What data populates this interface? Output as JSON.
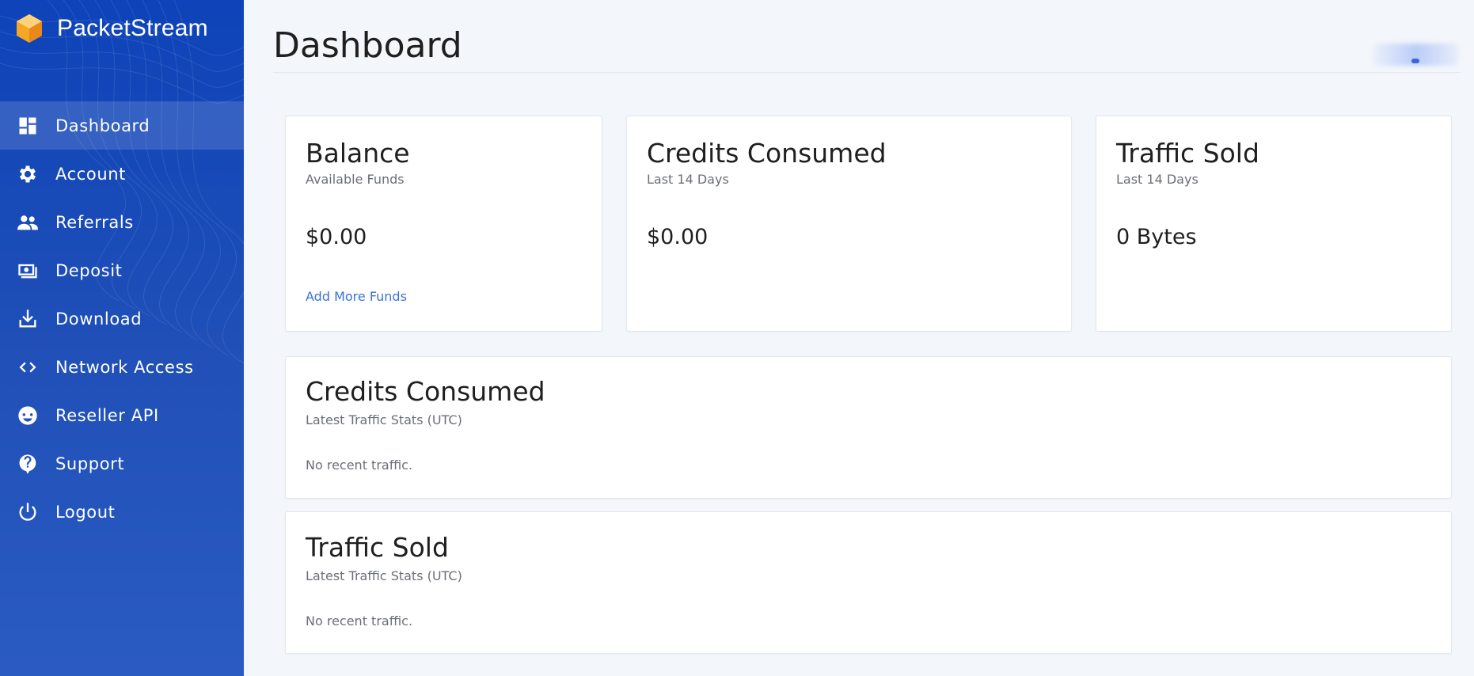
{
  "brand": {
    "name": "PacketStream",
    "logo_icon": "hexagon-cube-icon"
  },
  "sidebar": {
    "items": [
      {
        "label": "Dashboard",
        "icon": "dashboard-grid-icon",
        "active": true
      },
      {
        "label": "Account",
        "icon": "gear-icon"
      },
      {
        "label": "Referrals",
        "icon": "people-icon"
      },
      {
        "label": "Deposit",
        "icon": "cash-icon"
      },
      {
        "label": "Download",
        "icon": "download-tray-icon"
      },
      {
        "label": "Network Access",
        "icon": "code-brackets-icon"
      },
      {
        "label": "Reseller API",
        "icon": "api-face-icon"
      },
      {
        "label": "Support",
        "icon": "help-bubble-icon"
      },
      {
        "label": "Logout",
        "icon": "power-icon"
      }
    ]
  },
  "header": {
    "title": "Dashboard"
  },
  "cards": {
    "balance": {
      "title": "Balance",
      "subtitle": "Available Funds",
      "value": "$0.00",
      "link": "Add More Funds"
    },
    "credits_consumed": {
      "title": "Credits Consumed",
      "subtitle": "Last 14 Days",
      "value": "$0.00"
    },
    "traffic_sold": {
      "title": "Traffic Sold",
      "subtitle": "Last 14 Days",
      "value": "0 Bytes"
    }
  },
  "panels": {
    "credits_consumed": {
      "title": "Credits Consumed",
      "subtitle": "Latest Traffic Stats (UTC)",
      "empty": "No recent traffic."
    },
    "traffic_sold": {
      "title": "Traffic Sold",
      "subtitle": "Latest Traffic Stats (UTC)",
      "empty": "No recent traffic."
    }
  },
  "colors": {
    "sidebar_top": "#0e43b9",
    "sidebar_bottom": "#2a5bc2",
    "link": "#3a72d8",
    "page_bg": "#f3f6fb",
    "logo_orange": "#f5a623"
  }
}
